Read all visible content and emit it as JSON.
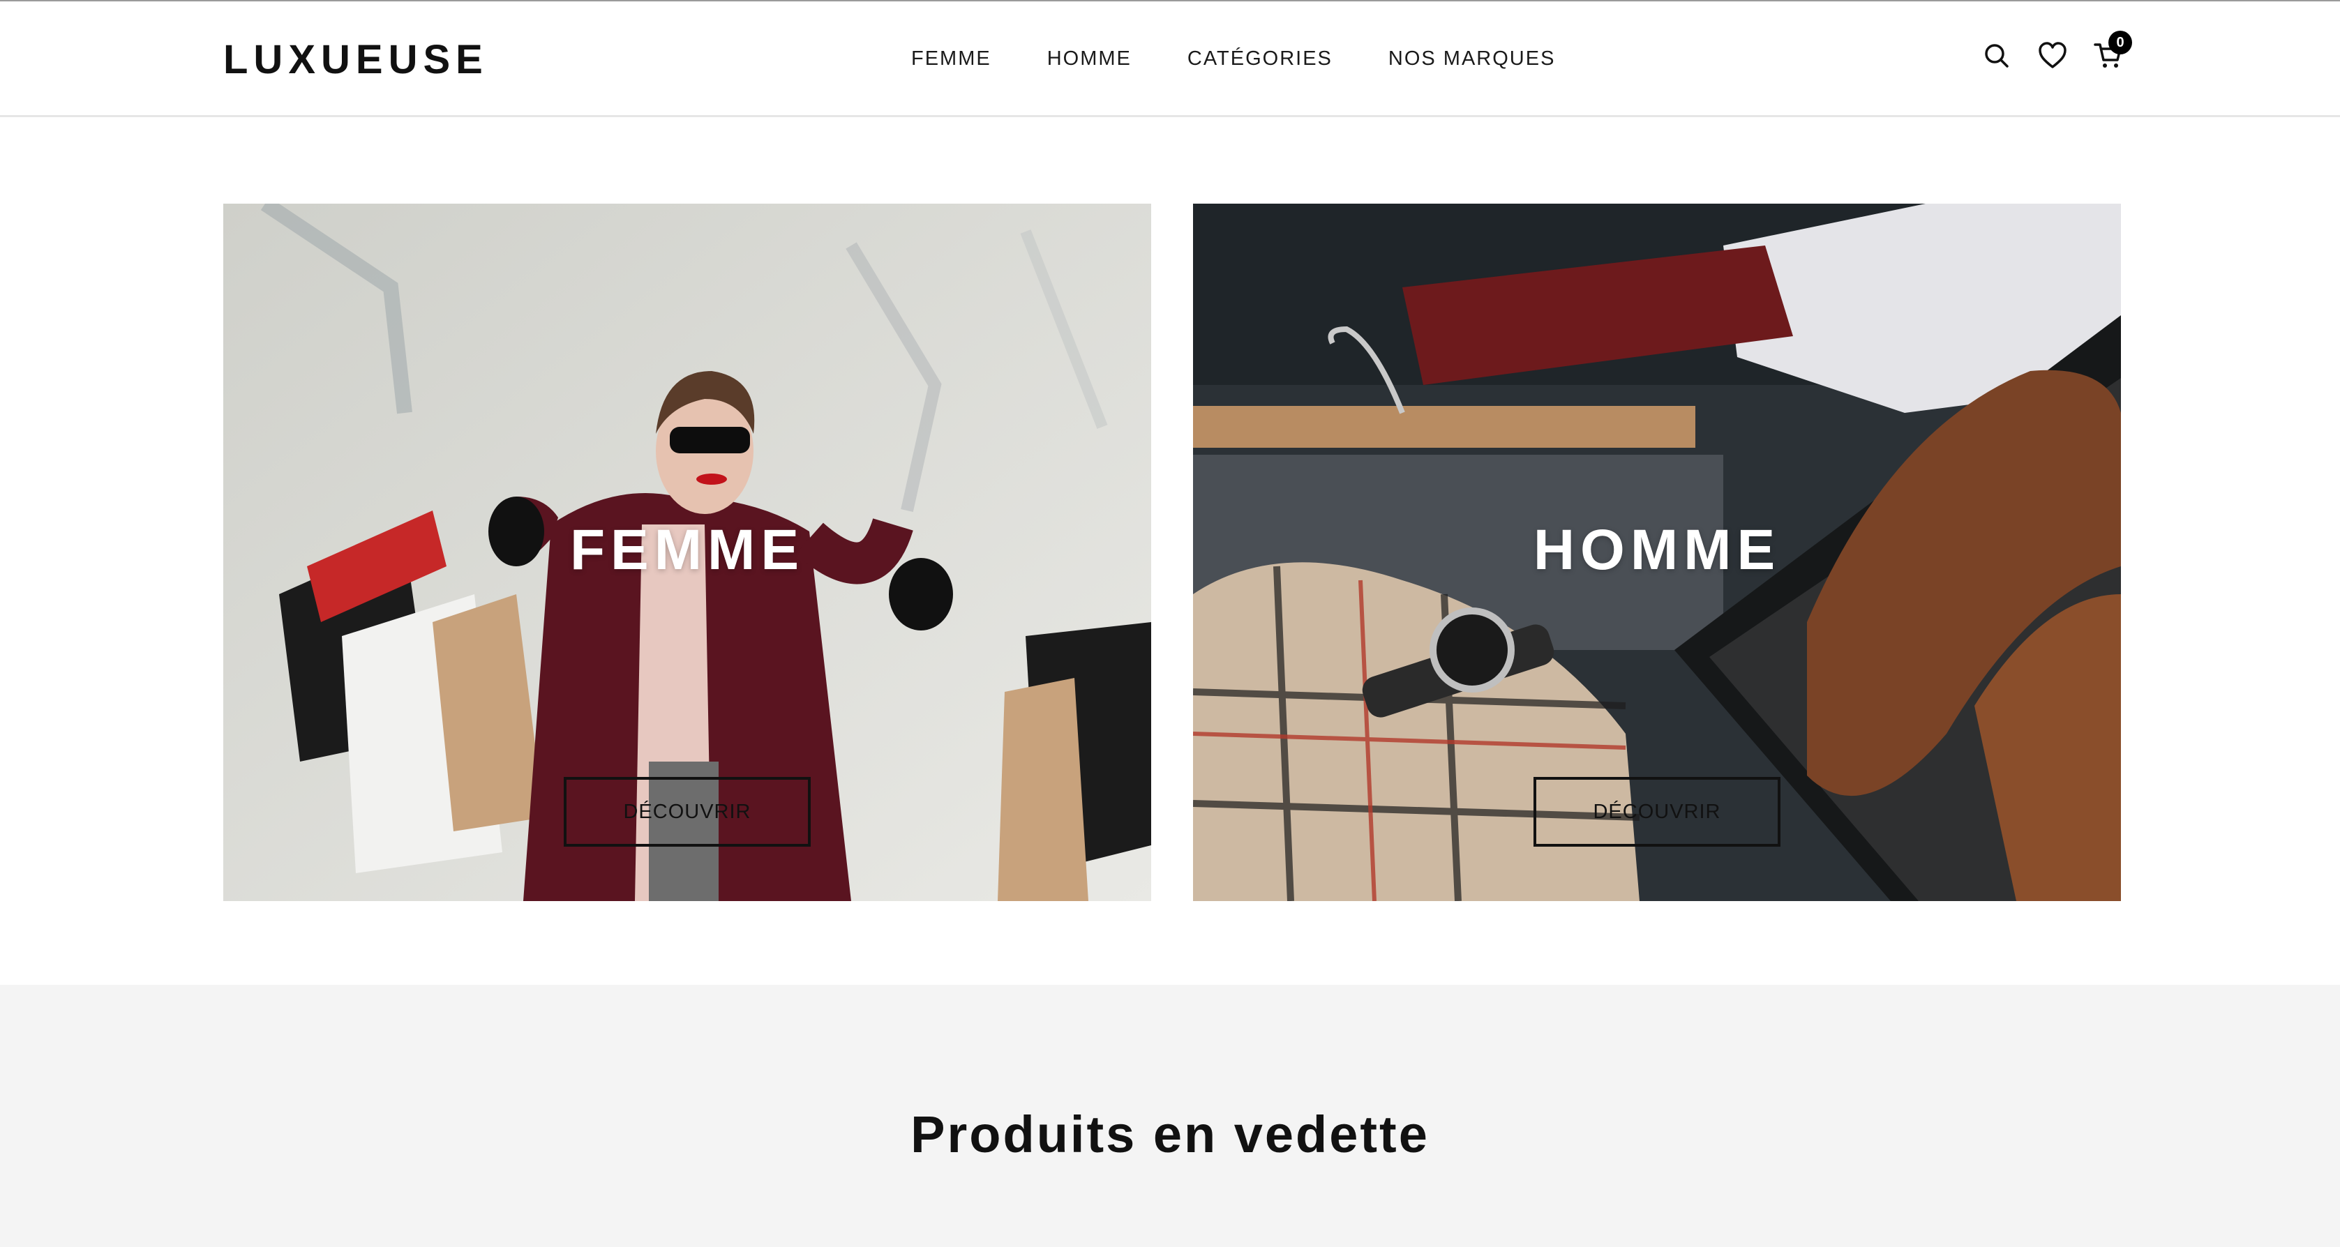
{
  "header": {
    "logo": "LUXUEUSE",
    "nav": [
      "FEMME",
      "HOMME",
      "CATÉGORIES",
      "NOS MARQUES"
    ],
    "cart_count": "0",
    "icons": [
      "search-icon",
      "heart-icon",
      "cart-icon"
    ]
  },
  "banners": [
    {
      "title": "FEMME",
      "button": "DÉCOUVRIR"
    },
    {
      "title": "HOMME",
      "button": "DÉCOUVRIR"
    }
  ],
  "featured": {
    "title": "Produits en vedette"
  },
  "colors": {
    "accent": "#000000",
    "featured_bg": "#f4f4f4",
    "header_border": "#e6e6e6"
  }
}
